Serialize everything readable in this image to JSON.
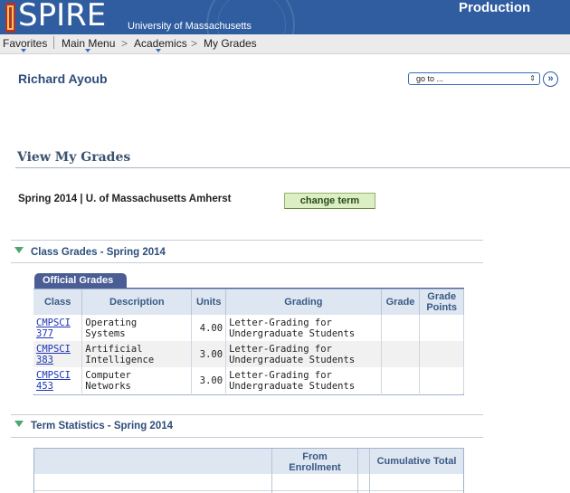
{
  "header": {
    "app_name": "SPIRE",
    "institution": "University of Massachusetts",
    "environment": "Production",
    "colors": {
      "header_bg": "#2f5d9f",
      "accent_green": "#49a86d"
    }
  },
  "nav": {
    "favorites": "Favorites",
    "main_menu": "Main Menu",
    "breadcrumb": [
      "Academics",
      "My Grades"
    ],
    "separator": ">"
  },
  "user": {
    "name": "Richard Ayoub"
  },
  "goto": {
    "selected": "go to ...",
    "button_icon": "double-chevron-right-icon"
  },
  "page": {
    "title": "View My Grades",
    "term_info": "Spring 2014 | U. of Massachusetts Amherst",
    "change_term_label": "change term"
  },
  "class_grades": {
    "title": "Class Grades - Spring 2014",
    "tab_label": "Official Grades",
    "columns": {
      "class": "Class",
      "description": "Description",
      "units": "Units",
      "grading": "Grading",
      "grade": "Grade",
      "grade_points_1": "Grade",
      "grade_points_2": "Points"
    },
    "rows": [
      {
        "class_1": "CMPSCI",
        "class_2": "377",
        "desc_1": "Operating",
        "desc_2": "Systems",
        "units": "4.00",
        "grading_1": "Letter-Grading for",
        "grading_2": "Undergraduate Students",
        "grade": "",
        "grade_points": ""
      },
      {
        "class_1": "CMPSCI",
        "class_2": "383",
        "desc_1": "Artificial",
        "desc_2": "Intelligence",
        "units": "3.00",
        "grading_1": "Letter-Grading for",
        "grading_2": "Undergraduate Students",
        "grade": "",
        "grade_points": ""
      },
      {
        "class_1": "CMPSCI",
        "class_2": "453",
        "desc_1": "Computer",
        "desc_2": "Networks",
        "units": "3.00",
        "grading_1": "Letter-Grading for",
        "grading_2": "Undergraduate Students",
        "grade": "",
        "grade_points": ""
      }
    ]
  },
  "term_statistics": {
    "title": "Term Statistics - Spring 2014",
    "columns": {
      "from_enrollment_1": "From",
      "from_enrollment_2": "Enrollment",
      "cumulative_total": "Cumulative Total"
    }
  }
}
